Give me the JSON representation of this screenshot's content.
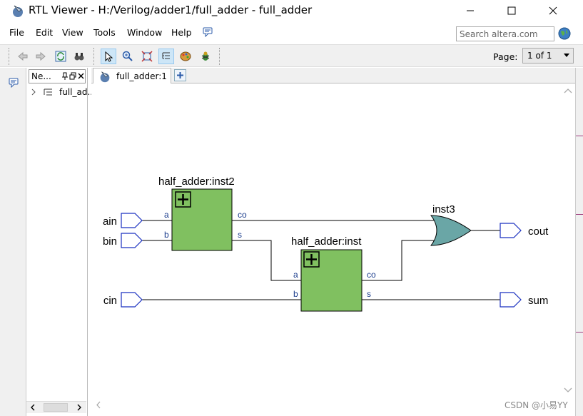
{
  "window": {
    "title": "RTL Viewer - H:/Verilog/adder1/full_adder - full_adder",
    "minimize_icon": "minimize-icon",
    "maximize_icon": "maximize-icon",
    "close_icon": "close-icon"
  },
  "menu": {
    "items": [
      {
        "label": "File"
      },
      {
        "label": "Edit"
      },
      {
        "label": "View"
      },
      {
        "label": "Tools"
      },
      {
        "label": "Window"
      },
      {
        "label": "Help"
      }
    ],
    "search_placeholder": "Search altera.com"
  },
  "toolbar": {
    "page_label": "Page:",
    "page_value": "1 of 1",
    "buttons": [
      "back-icon",
      "forward-icon",
      "refresh-icon",
      "find-icon",
      "select-icon",
      "zoom-icon",
      "fit-icon",
      "hierarchy-icon",
      "color-icon",
      "bug-icon"
    ]
  },
  "navigator": {
    "tab_label": "Ne...",
    "tree_item": "full_ad..."
  },
  "document": {
    "tab_label": "full_adder:1"
  },
  "schematic": {
    "inputs": [
      "ain",
      "bin",
      "cin"
    ],
    "outputs": [
      "cout",
      "sum"
    ],
    "block1": {
      "name": "half_adder:inst2",
      "ports_in": [
        "a",
        "b"
      ],
      "ports_out": [
        "co",
        "s"
      ]
    },
    "block2": {
      "name": "half_adder:inst",
      "ports_in": [
        "a",
        "b"
      ],
      "ports_out": [
        "co",
        "s"
      ]
    },
    "or_gate": {
      "name": "inst3"
    },
    "colors": {
      "block_fill": "#80c060",
      "gate_fill": "#6aa6a6",
      "port_stroke": "#1a30c0",
      "wire": "#000000",
      "pin_text": "#1a3c8c"
    }
  },
  "watermark": "CSDN @小易YY"
}
